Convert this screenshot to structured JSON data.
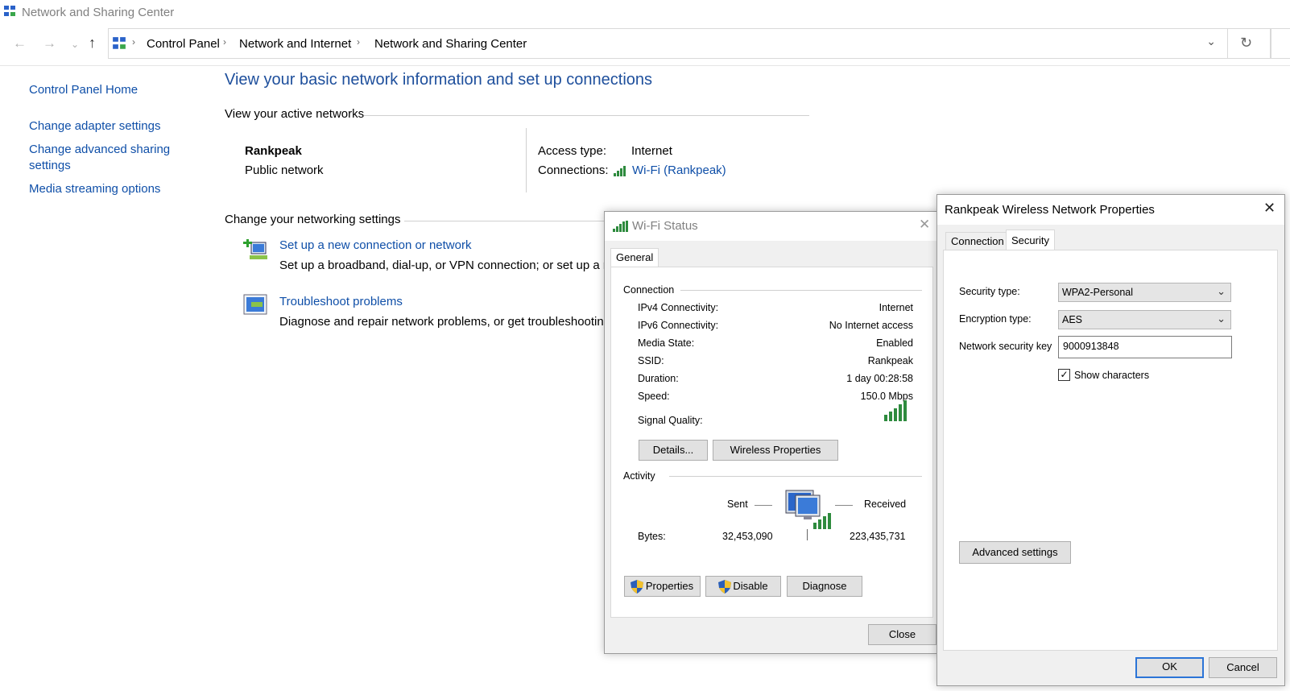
{
  "window": {
    "title": "Network and Sharing Center"
  },
  "address": {
    "crumbs": [
      "Control Panel",
      "Network and Internet",
      "Network and Sharing Center"
    ]
  },
  "sidebar": {
    "items": [
      {
        "label": "Control Panel Home"
      },
      {
        "label": "Change adapter settings"
      },
      {
        "label": "Change advanced sharing"
      },
      {
        "label": "settings"
      },
      {
        "label": "Media streaming options"
      }
    ]
  },
  "main": {
    "heading": "View your basic network information and set up connections",
    "active_networks_label": "View your active networks",
    "network": {
      "name": "Rankpeak",
      "type": "Public network",
      "access_type_label": "Access type:",
      "access_type_value": "Internet",
      "connections_label": "Connections:",
      "connections_value": "Wi-Fi (Rankpeak)"
    },
    "change_settings_label": "Change your networking settings",
    "actions": [
      {
        "title": "Set up a new connection or network",
        "desc": "Set up a broadband, dial-up, or VPN connection; or set up a r"
      },
      {
        "title": "Troubleshoot problems",
        "desc": "Diagnose and repair network problems, or get troubleshootin"
      }
    ]
  },
  "wifi_status": {
    "title": "Wi-Fi Status",
    "tab": "General",
    "connection_label": "Connection",
    "rows": [
      {
        "label": "IPv4 Connectivity:",
        "value": "Internet"
      },
      {
        "label": "IPv6 Connectivity:",
        "value": "No Internet access"
      },
      {
        "label": "Media State:",
        "value": "Enabled"
      },
      {
        "label": "SSID:",
        "value": "Rankpeak"
      },
      {
        "label": "Duration:",
        "value": "1 day 00:28:58"
      },
      {
        "label": "Speed:",
        "value": "150.0 Mbps"
      }
    ],
    "signal_label": "Signal Quality:",
    "details_button": "Details...",
    "wireless_properties_button": "Wireless Properties",
    "activity_label": "Activity",
    "sent_label": "Sent",
    "received_label": "Received",
    "bytes_label": "Bytes:",
    "bytes_sent": "32,453,090",
    "bytes_received": "223,435,731",
    "properties_button": "Properties",
    "disable_button": "Disable",
    "diagnose_button": "Diagnose",
    "close_button": "Close"
  },
  "wireless_props": {
    "title": "Rankpeak Wireless Network Properties",
    "tabs": [
      "Connection",
      "Security"
    ],
    "security_type_label": "Security type:",
    "security_type_value": "WPA2-Personal",
    "encryption_type_label": "Encryption type:",
    "encryption_type_value": "AES",
    "key_label": "Network security key",
    "key_value": "9000913848",
    "show_chars_label": "Show characters",
    "show_chars_checked": true,
    "advanced_button": "Advanced settings",
    "ok_button": "OK",
    "cancel_button": "Cancel"
  }
}
